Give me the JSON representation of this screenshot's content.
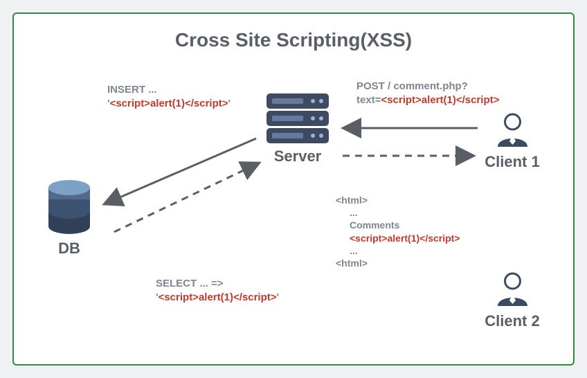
{
  "title": "Cross Site Scripting(XSS)",
  "nodes": {
    "db": "DB",
    "server": "Server",
    "client1": "Client 1",
    "client2": "Client 2"
  },
  "annotations": {
    "insert": {
      "line1": "INSERT ...",
      "line2_open": "'",
      "line2_script": "<script>alert(1)</script>",
      "line2_close": "'"
    },
    "post": {
      "line1": "POST / comment.php?",
      "line2_prefix": "text=",
      "line2_script": "<script>alert(1)</script>"
    },
    "html_block": {
      "l1": "<html>",
      "l2": "...",
      "l3": "Comments",
      "l4": "<script>alert(1)</script>",
      "l5": "...",
      "l6": "<html>"
    },
    "select": {
      "line1": "SELECT ... =>",
      "line2_open": "'",
      "line2_script": "<script>alert(1)</script>",
      "line2_close": "'"
    }
  }
}
